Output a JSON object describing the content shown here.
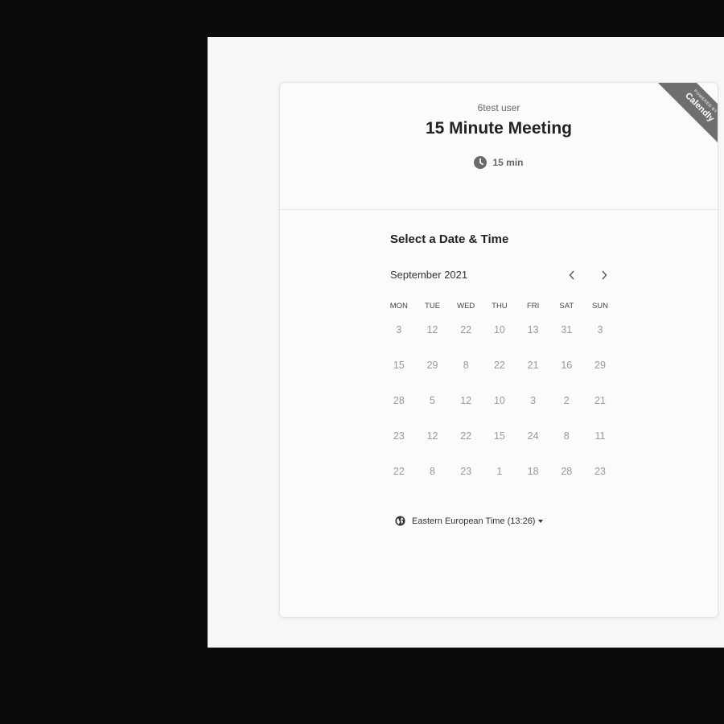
{
  "event": {
    "host": "6test user",
    "title": "15 Minute Meeting",
    "duration": "15 min"
  },
  "ribbon": {
    "small_text": "POWERED BY",
    "brand": "Calendly"
  },
  "scheduler": {
    "heading": "Select a Date & Time",
    "month": "September 2021",
    "weekdays": [
      "MON",
      "TUE",
      "WED",
      "THU",
      "FRI",
      "SAT",
      "SUN"
    ],
    "weeks": [
      [
        "3",
        "12",
        "22",
        "10",
        "13",
        "31",
        "3"
      ],
      [
        "15",
        "29",
        "8",
        "22",
        "21",
        "16",
        "29"
      ],
      [
        "28",
        "5",
        "12",
        "10",
        "3",
        "2",
        "21"
      ],
      [
        "23",
        "12",
        "22",
        "15",
        "24",
        "8",
        "11"
      ],
      [
        "22",
        "8",
        "23",
        "1",
        "18",
        "28",
        "23"
      ]
    ],
    "timezone": "Eastern European Time (13:26)"
  },
  "icons": {
    "duration": "clock-icon",
    "prev": "chevron-left-icon",
    "next": "chevron-right-icon",
    "timezone": "globe-icon",
    "dropdown": "caret-down-icon"
  },
  "colors": {
    "ribbon": "#6f6f6f",
    "day_text": "#999999"
  }
}
